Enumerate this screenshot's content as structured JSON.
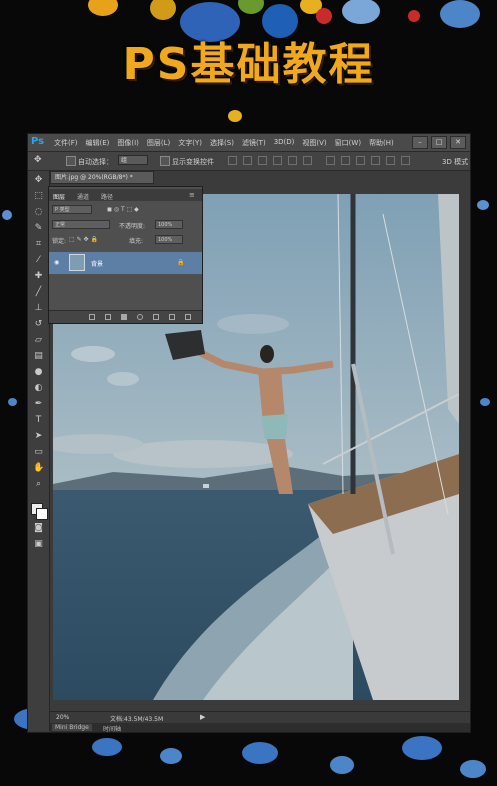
{
  "banner": {
    "title": "PS基础教程"
  },
  "menubar": {
    "logo": "Ps",
    "items": [
      "文件(F)",
      "编辑(E)",
      "图像(I)",
      "图层(L)",
      "文字(Y)",
      "选择(S)",
      "滤镜(T)",
      "3D(D)",
      "视图(V)",
      "窗口(W)",
      "帮助(H)"
    ],
    "window_controls": [
      "–",
      "□",
      "✕"
    ]
  },
  "options_bar": {
    "auto_select_label": "自动选择：",
    "auto_select_value": "组",
    "show_transform_label": "显示变换控件",
    "mode_label": "3D 模式"
  },
  "document": {
    "tab_title": "图片.jpg @ 20%(RGB/8*) *"
  },
  "layers_panel": {
    "tabs": [
      "图层",
      "通道",
      "路径"
    ],
    "filter_kind": "P 类型",
    "blend_mode": "正常",
    "opacity_label": "不透明度:",
    "opacity_value": "100%",
    "lock_label": "锁定:",
    "fill_label": "填充:",
    "fill_value": "100%",
    "layer_name": "背景"
  },
  "status_bar": {
    "zoom": "20%",
    "doc_info": "文档:43.5M/43.5M"
  },
  "bottom_tabs": [
    "Mini Bridge",
    "时间轴"
  ]
}
